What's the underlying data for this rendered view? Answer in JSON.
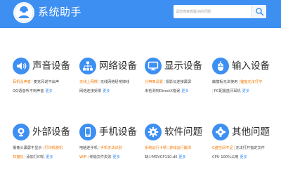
{
  "header": {
    "title": "系统助手",
    "search_placeholder": "请您搜索想解决的问题"
  },
  "colors": {
    "accent": "#3d8ff2",
    "highlight": "#f07800",
    "header_bg": "#3d8ff2"
  },
  "categories": [
    {
      "title": "声音设备",
      "icon": "speaker-icon",
      "line1": {
        "a": "耳机没声音",
        "b": "麦克风说不出声"
      },
      "line2": {
        "a": "QQ语音听不到声音",
        "more": "更多"
      }
    },
    {
      "title": "网络设备",
      "icon": "network-icon",
      "line1": {
        "a": "无线上网慢",
        "b": "无线网络经常掉线"
      },
      "line2": {
        "a": "网络连接受限",
        "more": "更多"
      }
    },
    {
      "title": "显示设备",
      "icon": "monitor-icon",
      "line1": {
        "a": "分辨率设置",
        "b": "投影仪连接黑屏"
      },
      "line2": {
        "a": "未检测到DirectX错误",
        "more": "更多"
      }
    },
    {
      "title": "输入设备",
      "icon": "input-icon",
      "line1": {
        "a": "触摸板无法使用",
        "b": "键盘无法打字"
      },
      "line2": {
        "a": "PC配置蓝牙耳机",
        "more": "更多"
      }
    },
    {
      "title": "外部设备",
      "icon": "camera-icon",
      "line1": {
        "a": "摄像头黑屏不显示",
        "b": "打印机脱机"
      },
      "line2": {
        "a": "扫描仪",
        "b": "添加打印机",
        "more": "更多"
      }
    },
    {
      "title": "手机设备",
      "icon": "phone-icon",
      "line1": {
        "a": "电脑连手机",
        "b": "手机无法识别"
      },
      "line2": {
        "a": "WiFi",
        "b": "传输文件失败",
        "more": "更多"
      }
    },
    {
      "title": "软件问题",
      "icon": "gear-icon",
      "line1": {
        "a": "系统运行卡顿",
        "b": "游戏运行崩溃"
      },
      "line2": {
        "a": "缺少MSVCP110.dll",
        "more": "更多"
      }
    },
    {
      "title": "其他问题",
      "icon": "question-icon",
      "line1": {
        "a": "C盘空间不足",
        "b": "无法打开指定文件"
      },
      "line2": {
        "a": "CPU 100%占用",
        "more": "更多"
      }
    }
  ]
}
